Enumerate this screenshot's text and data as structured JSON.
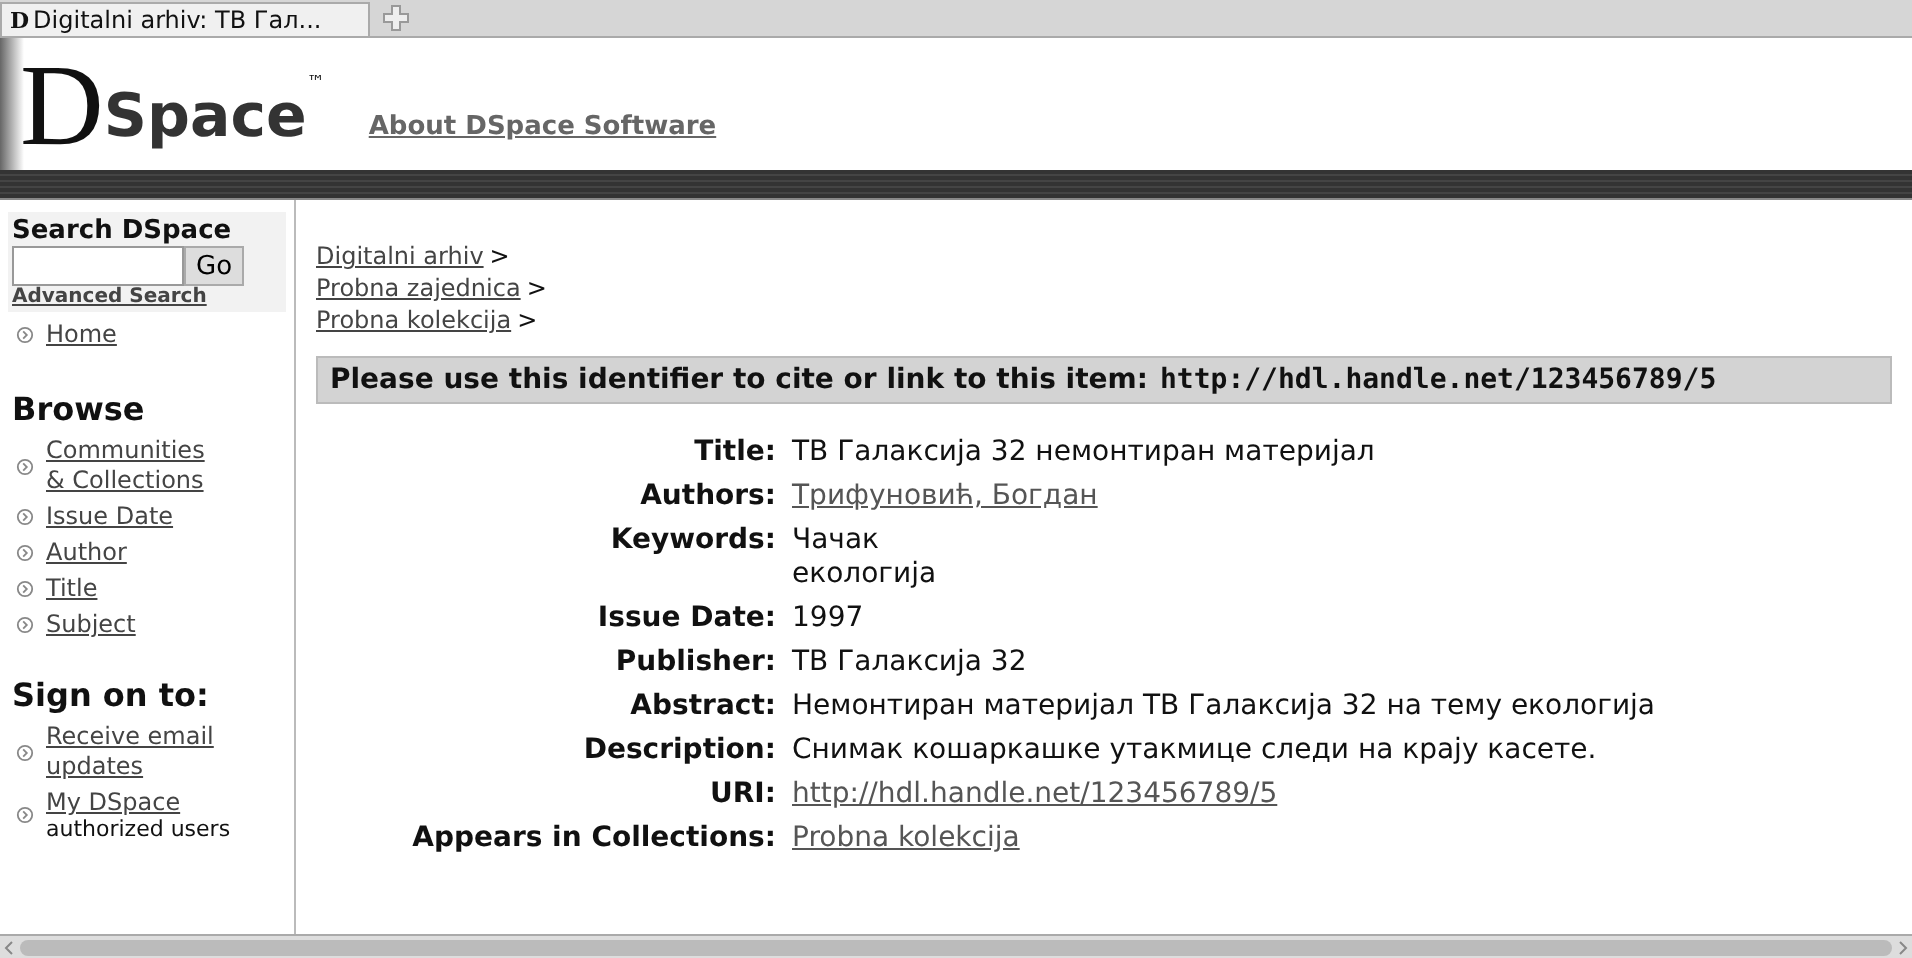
{
  "browser_tab": {
    "title": "Digitalni arhiv: ТВ Гал...",
    "favicon": "D"
  },
  "header": {
    "logo_letter": "D",
    "logo_word": "Space",
    "logo_mark": "™",
    "about_link": "About DSpace Software"
  },
  "sidebar": {
    "search_title": "Search DSpace",
    "go_button": "Go",
    "advanced_search": "Advanced Search",
    "home": "Home",
    "browse_title": "Browse",
    "browse_items": [
      "Communities & Collections",
      "Issue Date",
      "Author",
      "Title",
      "Subject"
    ],
    "sign_on_title": "Sign on to:",
    "sign_on_items": [
      {
        "label": "Receive email updates"
      },
      {
        "label": "My DSpace",
        "note": "authorized users"
      }
    ]
  },
  "breadcrumbs": [
    {
      "label": "Digitalni arhiv",
      "sep": ">"
    },
    {
      "label": "Probna zajednica",
      "sep": ">"
    },
    {
      "label": "Probna kolekcija",
      "sep": ">"
    }
  ],
  "cite_banner": {
    "text": "Please use this identifier to cite or link to this item:",
    "url": "http://hdl.handle.net/123456789/5"
  },
  "metadata": [
    {
      "label": "Title:",
      "kind": "text",
      "values": [
        "ТВ Галаксија 32 немонтиран материјал"
      ]
    },
    {
      "label": "Authors:",
      "kind": "link",
      "values": [
        "Трифуновић, Богдан"
      ]
    },
    {
      "label": "Keywords:",
      "kind": "text",
      "values": [
        "Чачак",
        "екологија"
      ]
    },
    {
      "label": "Issue Date:",
      "kind": "text",
      "values": [
        "1997"
      ]
    },
    {
      "label": "Publisher:",
      "kind": "text",
      "values": [
        "ТВ Галаксија 32"
      ]
    },
    {
      "label": "Abstract:",
      "kind": "text",
      "values": [
        "Немонтиран материјал ТВ Галаксија 32 на тему екологија"
      ]
    },
    {
      "label": "Description:",
      "kind": "text",
      "values": [
        "Снимак кошаркашке утакмице следи на крају касете."
      ]
    },
    {
      "label": "URI:",
      "kind": "link",
      "values": [
        "http://hdl.handle.net/123456789/5"
      ]
    },
    {
      "label": "Appears in Collections:",
      "kind": "link",
      "values": [
        "Probna kolekcija"
      ]
    }
  ]
}
